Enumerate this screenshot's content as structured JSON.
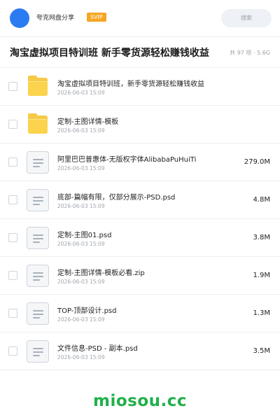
{
  "header": {
    "brand": "夸克网盘分享",
    "badge": "SVIP",
    "search_placeholder": "搜索"
  },
  "folder": {
    "title": "淘宝虚拟项目特训班 新手零货源轻松赚钱收益",
    "meta": "共 97 项 · 5.6G"
  },
  "files": [
    {
      "name": "淘宝虚拟项目特训班，新手零货源轻松赚钱收益",
      "date": "2026-06-03 15:09",
      "size": "",
      "type": "folder"
    },
    {
      "name": "定制-主图详情-模板",
      "date": "2026-06-03 15:09",
      "size": "",
      "type": "folder"
    },
    {
      "name": "阿里巴巴普惠体-无版权字体AlibabaPuHuiTi",
      "date": "2026-06-03 15:09",
      "size": "279.0M",
      "type": "file"
    },
    {
      "name": "底部-篇幅有限，仅部分展示-PSD.psd",
      "date": "2026-06-03 15:09",
      "size": "4.8M",
      "type": "file"
    },
    {
      "name": "定制-主图01.psd",
      "date": "2026-06-03 15:09",
      "size": "3.8M",
      "type": "file"
    },
    {
      "name": "定制-主图详情-模板必看.zip",
      "date": "2026-06-03 15:09",
      "size": "1.9M",
      "type": "file"
    },
    {
      "name": "TOP-顶部设计.psd",
      "date": "2026-06-03 15:09",
      "size": "1.3M",
      "type": "file"
    },
    {
      "name": "文件信息-PSD - 副本.psd",
      "date": "2026-06-03 15:09",
      "size": "3.5M",
      "type": "file"
    }
  ],
  "watermark": "miosou.cc",
  "colors": {
    "accent": "#2b7cf2",
    "badge": "#f5a623",
    "folder": "#f7c948",
    "watermark": "#20b04a"
  }
}
